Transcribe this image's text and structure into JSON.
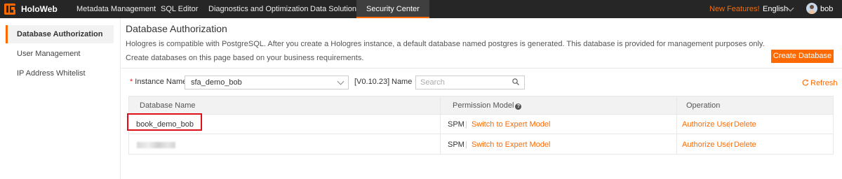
{
  "app": {
    "brand": "HoloWeb",
    "nav": [
      {
        "label": "Metadata Management",
        "active": false
      },
      {
        "label": "SQL Editor",
        "active": false
      },
      {
        "label": "Diagnostics and Optimization",
        "active": false
      },
      {
        "label": "Data Solution",
        "active": false
      },
      {
        "label": "Security Center",
        "active": true
      }
    ],
    "new_features": "New Features!",
    "language": "English",
    "user": "bob"
  },
  "sidebar": {
    "items": [
      {
        "label": "Database Authorization",
        "active": true
      },
      {
        "label": "User Management",
        "active": false
      },
      {
        "label": "IP Address Whitelist",
        "active": false
      }
    ]
  },
  "main": {
    "title": "Database Authorization",
    "description": "Hologres is compatible with PostgreSQL. After you create a Hologres instance, a default database named postgres is generated. This database is provided for management purposes only. Create databases on this page based on your business requirements.",
    "create_button": "Create Database",
    "filters": {
      "required_mark": "*",
      "instance_label": "Instance Name",
      "instance_value": "sfa_demo_bob",
      "version": "[V0.10.23]",
      "name_label": "Name",
      "search_placeholder": "Search"
    },
    "refresh": "Refresh",
    "table": {
      "columns": [
        "Database Name",
        "Permission Model",
        "Operation"
      ],
      "rows": [
        {
          "name": "book_demo_bob",
          "model": "SPM",
          "switch": "Switch to Expert Model",
          "authorize": "Authorize User",
          "delete": "Delete"
        },
        {
          "name": "",
          "model": "SPM",
          "switch": "Switch to Expert Model",
          "authorize": "Authorize User",
          "delete": "Delete"
        }
      ],
      "separator": "|"
    }
  },
  "colors": {
    "accent": "#ff6a00",
    "topbar": "#262626",
    "highlight": "#e0101a"
  }
}
